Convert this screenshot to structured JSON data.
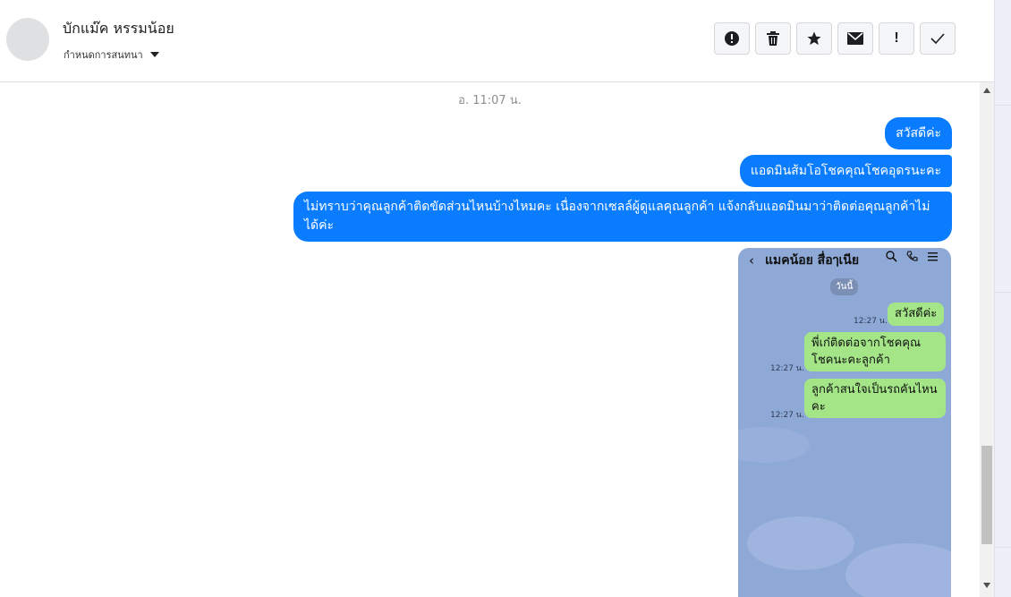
{
  "header": {
    "contact_name": "บักแม๊ค หรรมน้อย",
    "assign_label": "กำหนดการสนทนา",
    "actions": [
      {
        "icon": "alert-circle-icon",
        "name": "report-button"
      },
      {
        "icon": "trash-icon",
        "name": "delete-button"
      },
      {
        "icon": "star-icon",
        "name": "star-button"
      },
      {
        "icon": "envelope-icon",
        "name": "mark-unread-button"
      },
      {
        "icon": "exclamation-icon",
        "name": "mark-spam-button",
        "glyph": "!"
      },
      {
        "icon": "check-icon",
        "name": "mark-done-button"
      }
    ]
  },
  "conversation": {
    "timestamp": "อ. 11:07 น.",
    "messages": [
      {
        "text": "สวัสดีค่ะ"
      },
      {
        "text": "แอดมินส้มโอโชคคุณโชคอุดรนะคะ"
      },
      {
        "text": "ไม่ทราบว่าคุณลูกค้าติดขัดส่วนไหนบ้างไหมคะ เนื่องจากเซลล์ผู้ดูแลคุณลูกค้า แจ้งกลับแอดมินมาว่าติดต่อคุณลูกค้าไม่ได้ค่ะ"
      }
    ],
    "attachment": {
      "chat_title": "แมคน้อย สื่อๅเนีย",
      "date_label": "วันนี้",
      "messages": [
        {
          "time": "12:27 น.",
          "text": "สวัสดีค่ะ"
        },
        {
          "time": "12:27 น.",
          "text": "พี่เก๋ติดต่อจากโชคคุณโชคนะคะลูกค้า"
        },
        {
          "time": "12:27 น.",
          "text": "ลูกค้าสนใจเป็นรถคันไหนคะ"
        }
      ]
    }
  },
  "colors": {
    "bubble_blue": "#0a7cff",
    "attachment_bg": "#8fa9d6",
    "line_green_bubble": "#a4e687"
  }
}
